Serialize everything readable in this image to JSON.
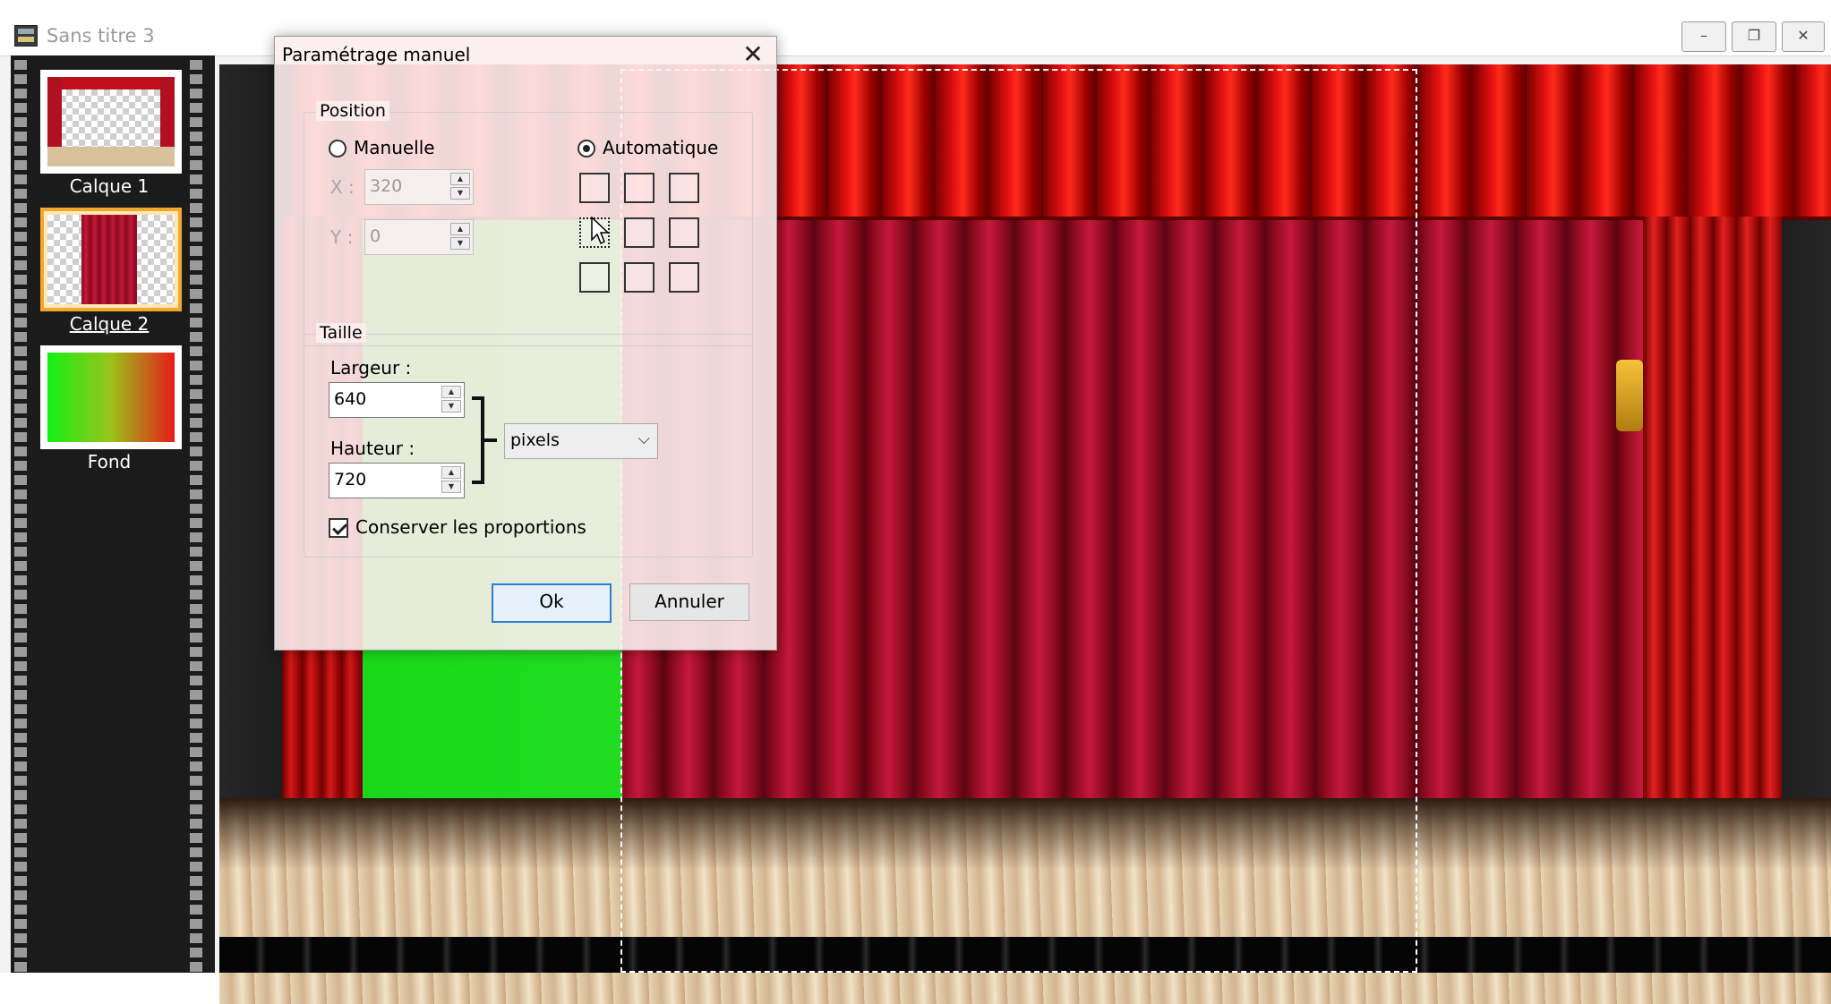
{
  "window": {
    "title": "Sans titre 3",
    "controls": {
      "minimize": "–",
      "restore": "❐",
      "close": "✕"
    }
  },
  "layers": [
    {
      "label": "Calque 1",
      "selected": false,
      "icon": "stage-thumbnail"
    },
    {
      "label": "Calque 2",
      "selected": true,
      "icon": "curtain-thumbnail"
    },
    {
      "label": "Fond",
      "selected": false,
      "icon": "green-red-gradient-thumbnail"
    }
  ],
  "dialog": {
    "title": "Paramétrage manuel",
    "close_glyph": "✕",
    "position": {
      "title": "Position",
      "manual_label": "Manuelle",
      "auto_label": "Automatique",
      "mode": "Automatique",
      "x_label": "X :",
      "x_value": "320",
      "y_label": "Y :",
      "y_value": "0",
      "anchor_selected": "middle-left"
    },
    "size": {
      "title": "Taille",
      "width_label": "Largeur :",
      "width_value": "640",
      "height_label": "Hauteur :",
      "height_value": "720",
      "unit": "pixels",
      "keep_ratio_label": "Conserver les proportions",
      "keep_ratio": true
    },
    "ok_label": "Ok",
    "cancel_label": "Annuler"
  },
  "colors": {
    "accent": "#2d7fd0",
    "selected_layer": "#f0a830",
    "curtain_red": "#c4193a",
    "backdrop_green": "#1ed81e",
    "backdrop_orange": "#e44a10"
  }
}
